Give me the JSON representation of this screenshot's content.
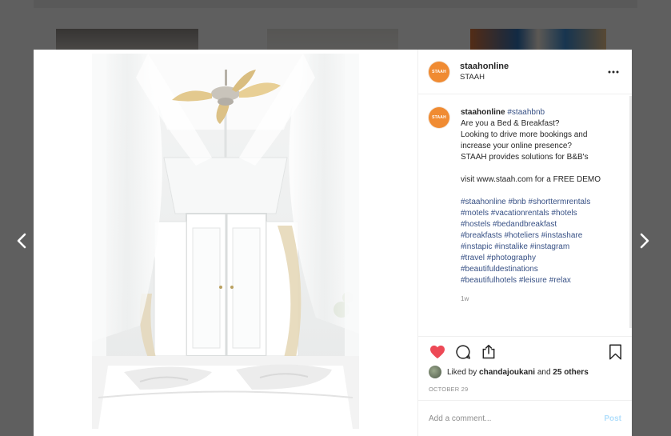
{
  "post": {
    "username": "staahonline",
    "subtitle": "STAAH",
    "avatar_text": "STAAH",
    "caption": {
      "username": "staahonline",
      "hashtag_inline": "#staahbnb",
      "lines": [
        "Are you a Bed & Breakfast?",
        "Looking to drive more bookings and",
        "increase your online presence?",
        "STAAH provides solutions for B&B's",
        "",
        "visit www.staah.com for a FREE DEMO",
        ""
      ],
      "hashtag_lines": [
        [
          "#staahonline",
          "#bnb",
          "#shorttermrentals"
        ],
        [
          "#motels",
          "#vacationrentals",
          "#hotels"
        ],
        [
          "#hostels",
          "#bedandbreakfast"
        ],
        [
          "#breakfasts",
          "#hoteliers",
          "#instashare"
        ],
        [
          "#instapic",
          "#instalike",
          "#instagram"
        ],
        [
          "#travel",
          "#photography"
        ],
        [
          "#beautifuldestinations"
        ],
        [
          "#beautifulhotels",
          "#leisure",
          "#relax"
        ]
      ],
      "time_ago": "1w"
    },
    "likes": {
      "prefix": "Liked by",
      "user": "chandajoukani",
      "middle": "and",
      "others": "25 others"
    },
    "date": "OCTOBER 29"
  },
  "comment": {
    "placeholder": "Add a comment...",
    "post_label": "Post"
  },
  "icons": {
    "like": "heart-icon",
    "comment": "comment-icon",
    "share": "share-icon",
    "save": "bookmark-icon",
    "more": "more-dots-icon",
    "prev": "chevron-left-icon",
    "next": "chevron-right-icon"
  },
  "colors": {
    "liked": "#ed4956",
    "hashtag": "#385185",
    "avatar": "#f08b32",
    "post_disabled": "#b2dffc"
  }
}
